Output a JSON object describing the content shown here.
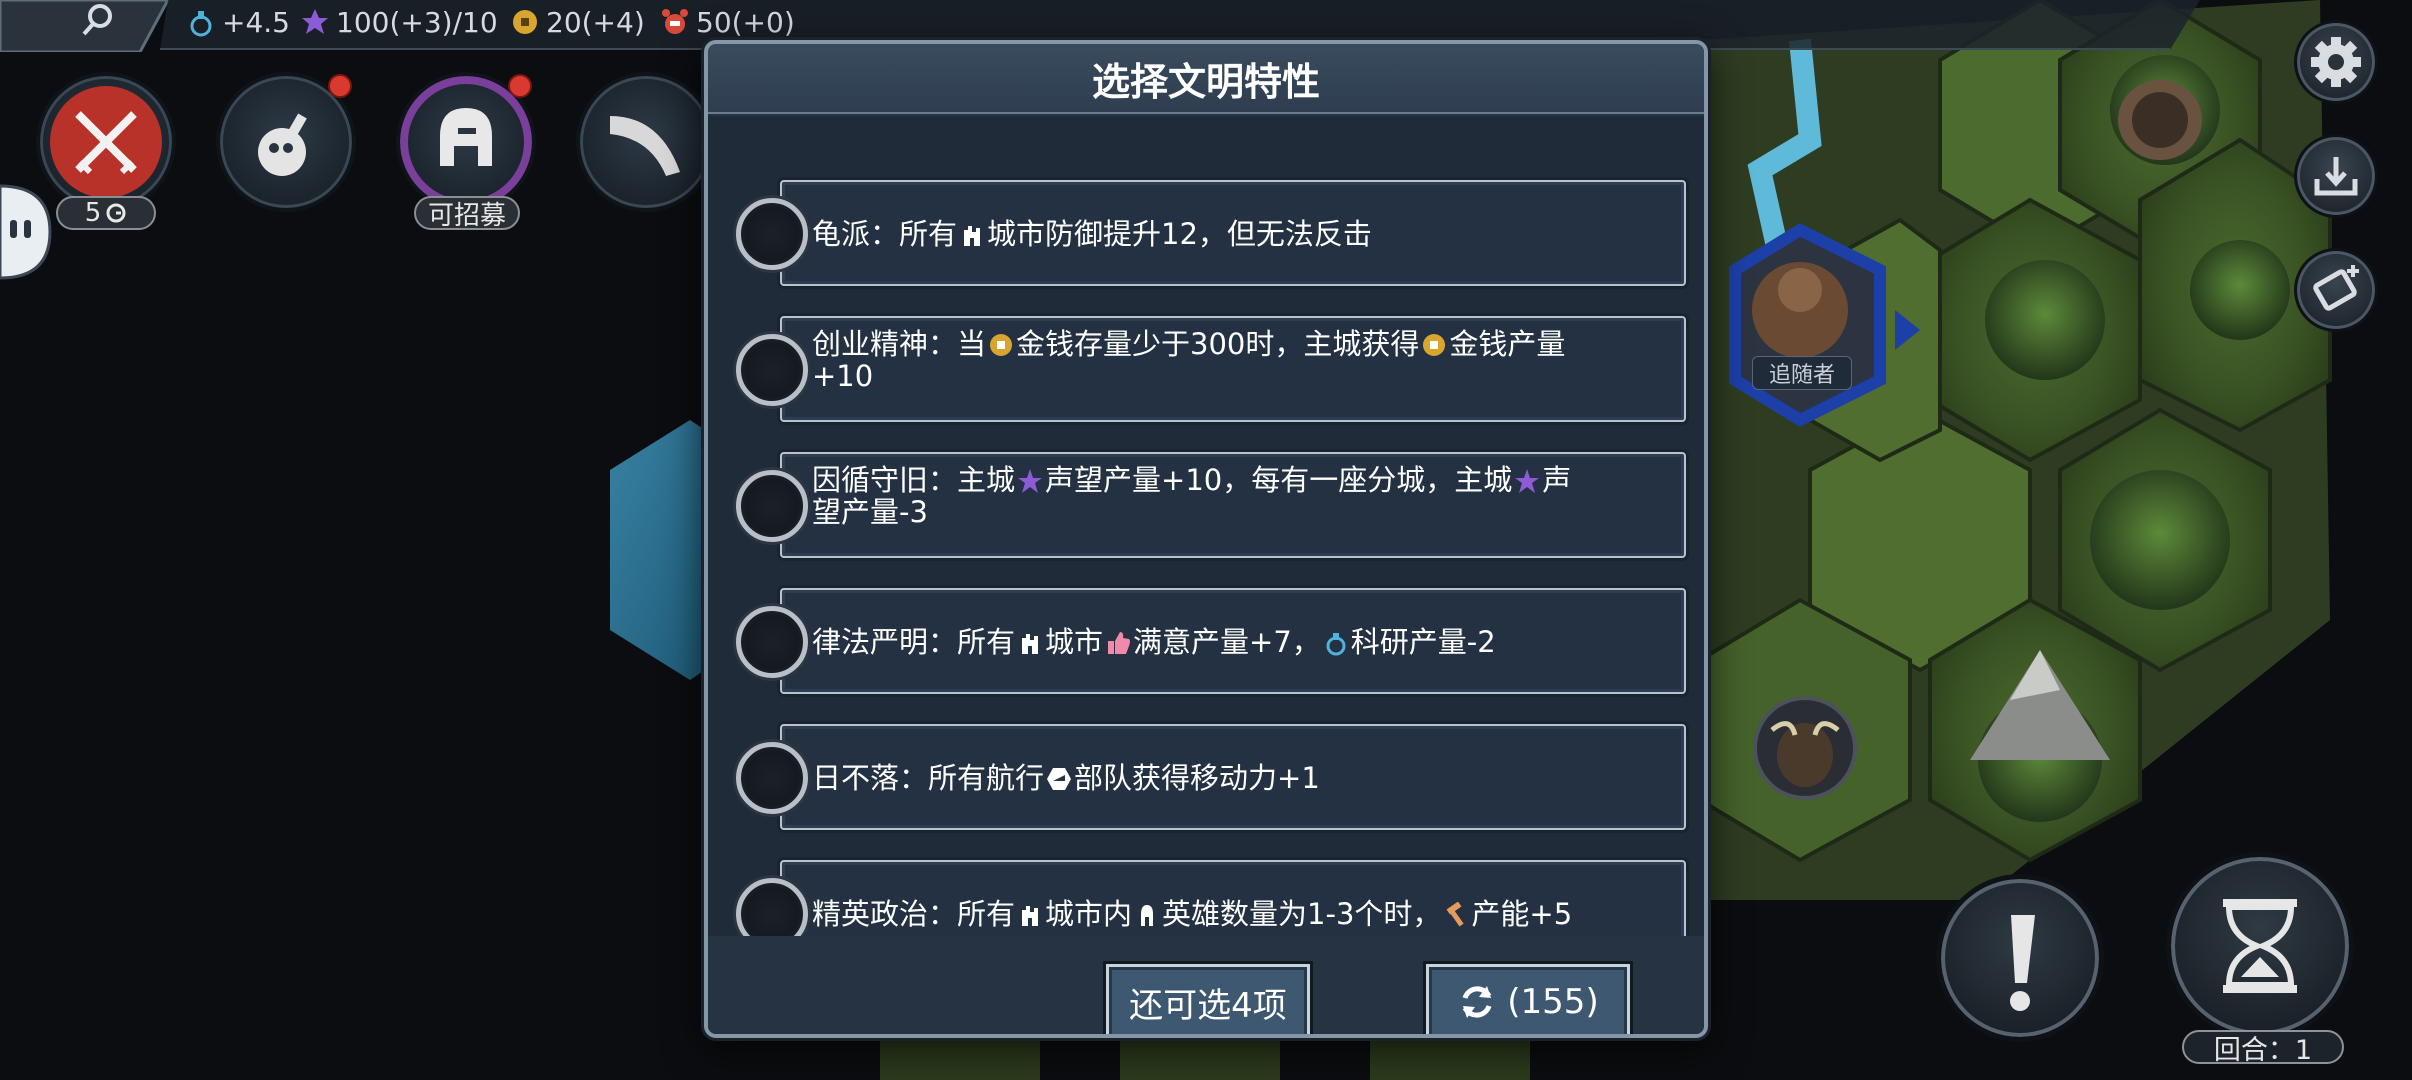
{
  "resources": [
    {
      "name": "science",
      "icon": "flask-icon",
      "value": "+4.5",
      "color": "#4fb3d9"
    },
    {
      "name": "prestige",
      "icon": "star-icon",
      "value": "100(+3)/10",
      "color": "#8e5bd6"
    },
    {
      "name": "gold",
      "icon": "coin-icon",
      "value": "20(+4)",
      "color": "#d8a62e"
    },
    {
      "name": "food",
      "icon": "alarm-icon",
      "value": "50(+0)",
      "color": "#d84a3a"
    }
  ],
  "left_buttons": {
    "war_badge": "5",
    "recruit_badge": "可招募"
  },
  "unit_label": "追随者",
  "turn_label": "回合：1",
  "modal": {
    "title": "选择文明特性",
    "options": [
      {
        "parts": [
          "龟派：所有",
          "城市防御提升12，但无法反击"
        ]
      },
      {
        "parts": [
          "创业精神：当",
          "金钱存量少于300时，主城获得",
          "金钱产量",
          "+10"
        ]
      },
      {
        "parts": [
          "因循守旧：主城",
          "声望产量+10，每有一座分城，主城",
          "声",
          "望产量-3"
        ]
      },
      {
        "parts": [
          "律法严明：所有",
          "城市",
          "满意产量+7，",
          "科研产量-2"
        ]
      },
      {
        "parts": [
          "日不落：所有航行",
          "部队获得移动力+1"
        ]
      },
      {
        "parts": [
          "精英政治：所有",
          "城市内",
          "英雄数量为1-3个时，",
          "产能+5"
        ]
      }
    ],
    "remaining_button": "还可选4项",
    "refresh_count": "(155)"
  },
  "colors": {
    "modal_bg": "#263342",
    "button_bg": "#3d5870",
    "accent_purple": "#8e5bd6",
    "accent_gold": "#d8a62e"
  }
}
